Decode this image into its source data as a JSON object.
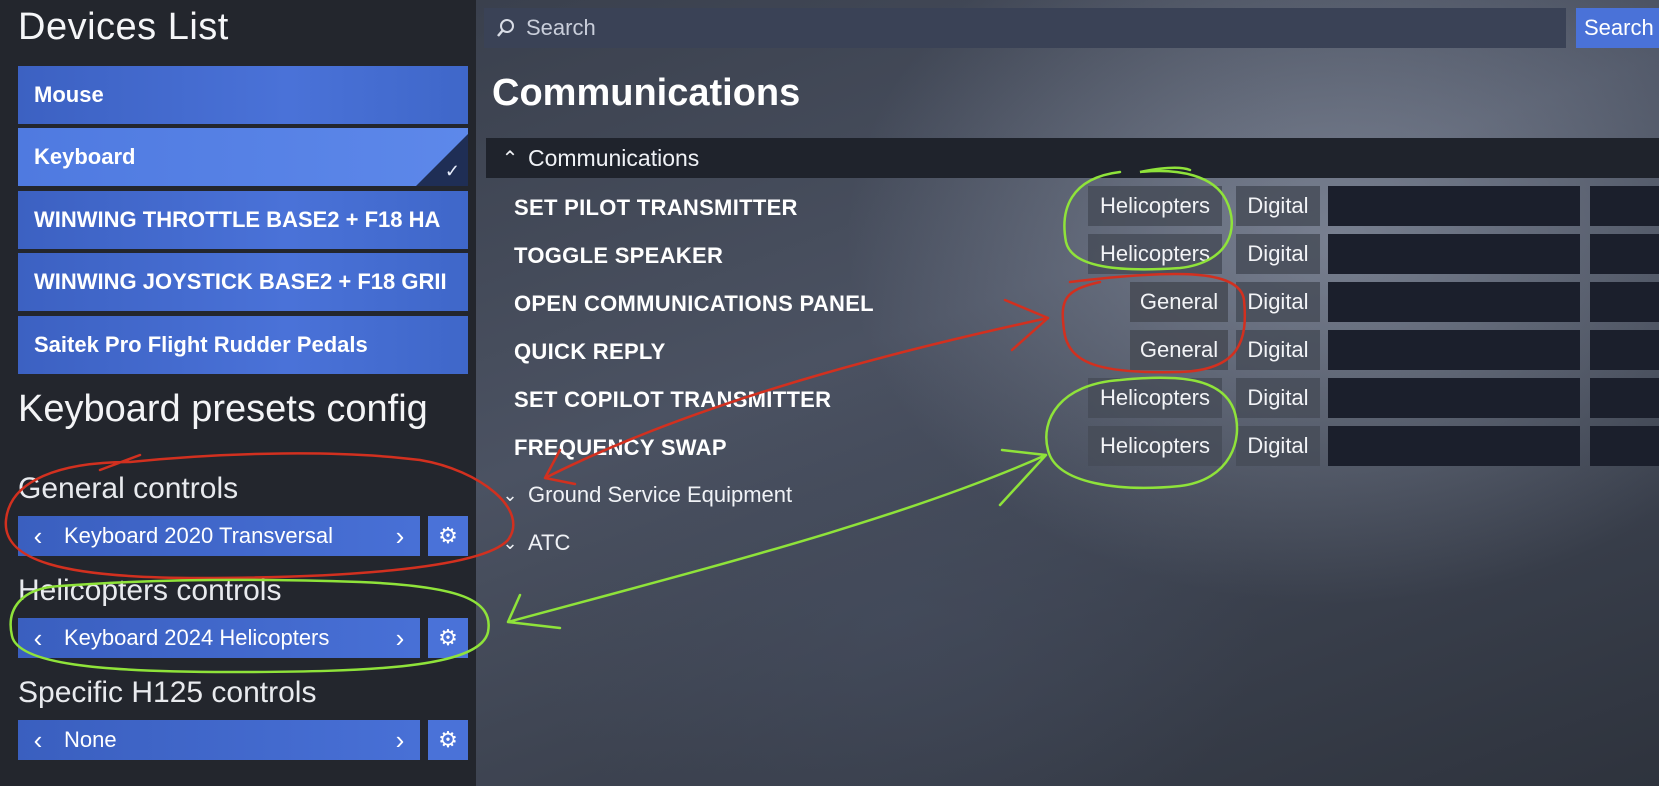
{
  "sidebar": {
    "title": "Devices List",
    "devices": [
      {
        "label": "Mouse"
      },
      {
        "label": "Keyboard"
      },
      {
        "label": "WINWING THROTTLE BASE2 + F18 HA"
      },
      {
        "label": "WINWING JOYSTICK BASE2 + F18 GRII"
      },
      {
        "label": "Saitek Pro Flight Rudder Pedals"
      }
    ],
    "selected_check": "✓",
    "presets_title": "Keyboard presets config",
    "presets": [
      {
        "label": "General controls",
        "value": "Keyboard 2020 Transversal"
      },
      {
        "label": "Helicopters controls",
        "value": "Keyboard 2024 Helicopters"
      },
      {
        "label": "Specific H125 controls",
        "value": "None"
      }
    ],
    "arrow_left": "‹",
    "arrow_right": "›",
    "gear": "⚙"
  },
  "search": {
    "placeholder": "Search",
    "icon": "search-icon",
    "button_label": "Search"
  },
  "main": {
    "title": "Communications",
    "expanded_category": {
      "label": "Communications",
      "chevron": "⌃"
    },
    "rows": [
      {
        "name": "SET PILOT TRANSMITTER",
        "scope": "Helicopters",
        "type": "Digital"
      },
      {
        "name": "TOGGLE SPEAKER",
        "scope": "Helicopters",
        "type": "Digital"
      },
      {
        "name": "OPEN COMMUNICATIONS PANEL",
        "scope": "General",
        "type": "Digital"
      },
      {
        "name": "QUICK REPLY",
        "scope": "General",
        "type": "Digital"
      },
      {
        "name": "SET COPILOT TRANSMITTER",
        "scope": "Helicopters",
        "type": "Digital"
      },
      {
        "name": "FREQUENCY SWAP",
        "scope": "Helicopters",
        "type": "Digital"
      }
    ],
    "collapsed_categories": [
      {
        "label": "Ground Service Equipment",
        "chevron": "⌄"
      },
      {
        "label": "ATC",
        "chevron": "⌄"
      }
    ]
  },
  "annotation_colors": {
    "red": "#d2301f",
    "green": "#8fe33a"
  }
}
